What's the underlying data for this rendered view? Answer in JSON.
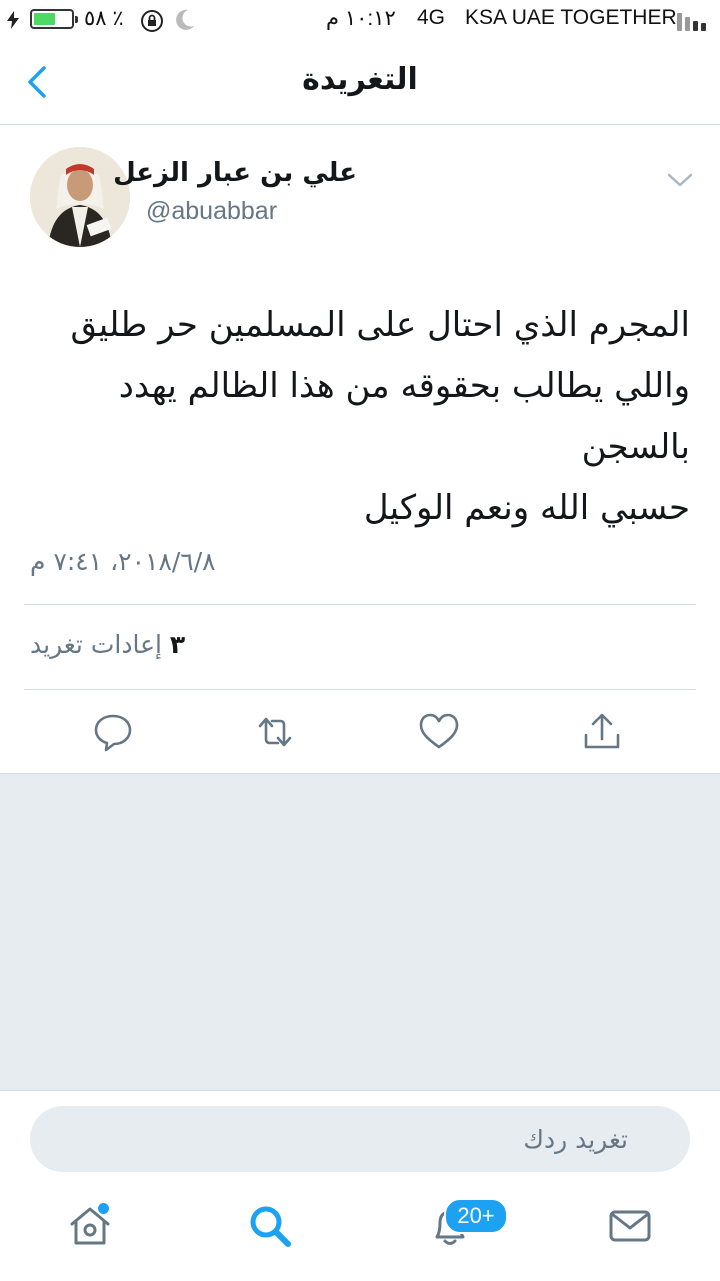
{
  "status_bar": {
    "battery_percent": "٥٨ ٪",
    "battery_level": 0.58,
    "time": "١٠:١٢ م",
    "network": "4G",
    "carrier": "KSA UAE TOGETHER"
  },
  "header": {
    "title": "التغريدة"
  },
  "tweet": {
    "author_name": "علي بن عبار الزعل",
    "author_handle": "@abuabbar",
    "lines": [
      "المجرم الذي احتال على المسلمين حر طليق",
      "واللي يطالب بحقوقه من هذا الظالم يهدد",
      "بالسجن",
      "حسبي الله ونعم الوكيل"
    ],
    "timestamp": "٢٠١٨/٦/٨، ٧:٤١ م",
    "retweet_count": "٣",
    "retweet_label": "إعادات تغريد"
  },
  "composer": {
    "placeholder": "تغريد ردك"
  },
  "tabbar": {
    "notifications_badge": "20+"
  },
  "colors": {
    "accent": "#1da1f2",
    "secondary_text": "#657786",
    "background_gray": "#e6ecf0"
  },
  "icons": {
    "actions": [
      "reply-icon",
      "retweet-icon",
      "like-icon",
      "share-icon"
    ],
    "tabs": [
      "home-icon",
      "search-icon",
      "notifications-icon",
      "messages-icon"
    ]
  }
}
